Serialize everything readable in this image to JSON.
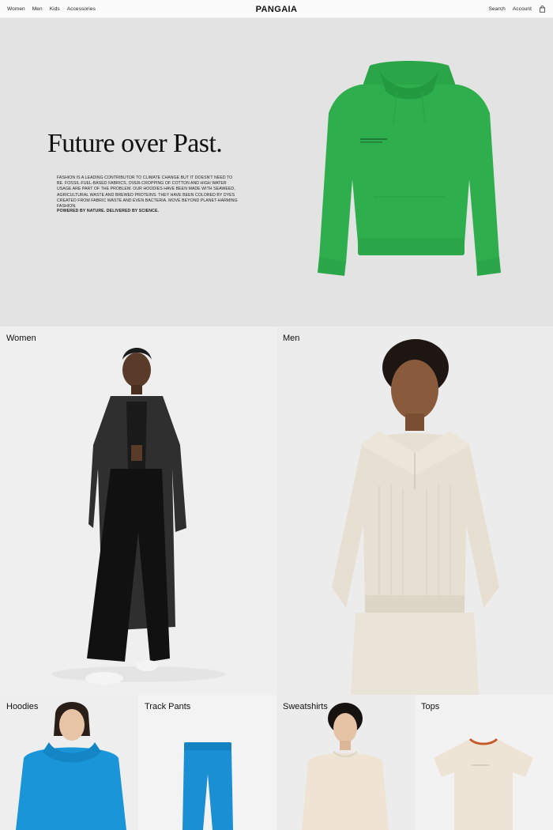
{
  "nav": {
    "links": [
      "Women",
      "Men",
      "Kids",
      "Accessories"
    ],
    "brand": "PANGAIA",
    "search": "Search",
    "account": "Account",
    "bag_icon": "shopping-bag-icon"
  },
  "hero": {
    "title": "Future over Past.",
    "body": "Fashion is a leading contributor to climate change but it doesn't need to be. Fossil-fuel-based fabrics, over-cropping of cotton and high water usage are part of the problem. Our hoodies have been made with seaweed, agricultural waste and brewed proteins. They have been colored by dyes created from fabric waste and even bacteria. Move beyond planet-harming fashion.",
    "tagline": "Powered by nature. Delivered by science.",
    "product_color": "#2fae4e"
  },
  "categories": [
    {
      "label": "Women"
    },
    {
      "label": "Men"
    },
    {
      "label": "Hoodies"
    },
    {
      "label": "Track Pants"
    },
    {
      "label": "Sweatshirts"
    },
    {
      "label": "Tops"
    }
  ],
  "colors": {
    "hero_bg": "#e3e3e3",
    "hoodie_green": "#2fae4e",
    "hoodie_blue": "#1a95d8",
    "pants_blue": "#1a8fd4",
    "cream": "#eee4d6"
  }
}
